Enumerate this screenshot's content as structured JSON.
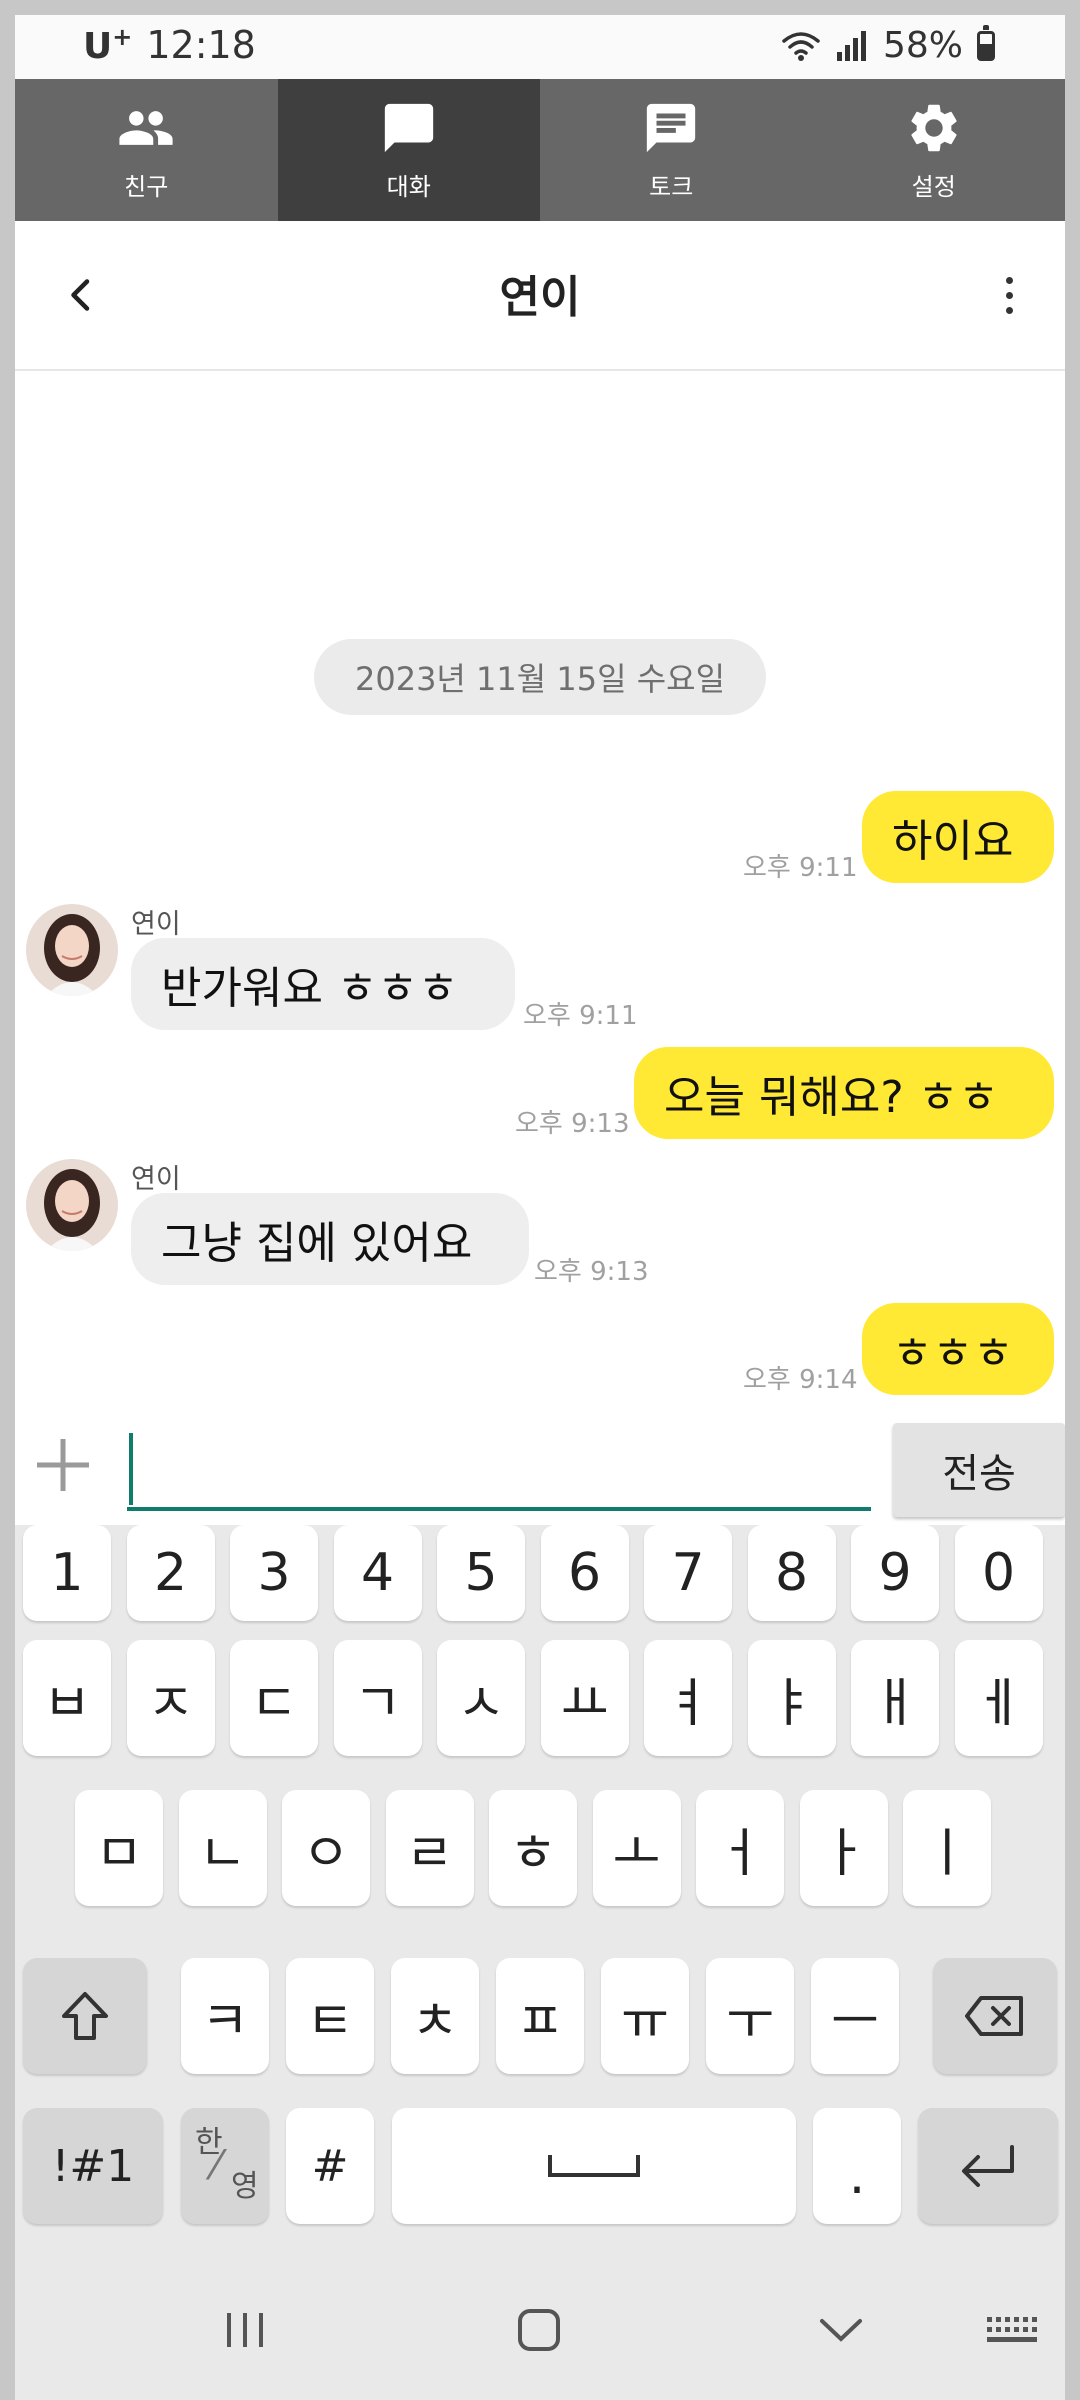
{
  "status_bar": {
    "carrier": "U",
    "carrier_sup": "+",
    "time": "12:18",
    "battery": "58%"
  },
  "tabs": [
    {
      "label": "친구",
      "icon": "friends-icon",
      "active": false
    },
    {
      "label": "대화",
      "icon": "chat-bubble-icon",
      "active": true
    },
    {
      "label": "토크",
      "icon": "message-icon",
      "active": false
    },
    {
      "label": "설정",
      "icon": "gear-icon",
      "active": false
    }
  ],
  "chat": {
    "title": "연이",
    "date_divider": "2023년 11월 15일 수요일",
    "messages": [
      {
        "from": "me",
        "text": "하이요",
        "time": "오후 9:11"
      },
      {
        "from": "them",
        "sender": "연이",
        "text": "반가워요 ㅎㅎㅎ",
        "time": "오후 9:11"
      },
      {
        "from": "me",
        "text": "오늘 뭐해요? ㅎㅎ",
        "time": "오후 9:13"
      },
      {
        "from": "them",
        "sender": "연이",
        "text": "그냥 집에 있어요",
        "time": "오후 9:13"
      },
      {
        "from": "me",
        "text": "ㅎㅎㅎ",
        "time": "오후 9:14"
      }
    ]
  },
  "input": {
    "value": "",
    "placeholder": "",
    "send_label": "전송"
  },
  "keyboard": {
    "row_numbers": [
      "1",
      "2",
      "3",
      "4",
      "5",
      "6",
      "7",
      "8",
      "9",
      "0"
    ],
    "row1": [
      "ㅂ",
      "ㅈ",
      "ㄷ",
      "ㄱ",
      "ㅅ",
      "ㅛ",
      "ㅕ",
      "ㅑ",
      "ㅐ",
      "ㅔ"
    ],
    "row2": [
      "ㅁ",
      "ㄴ",
      "ㅇ",
      "ㄹ",
      "ㅎ",
      "ㅗ",
      "ㅓ",
      "ㅏ",
      "ㅣ"
    ],
    "row3": [
      "ㅋ",
      "ㅌ",
      "ㅊ",
      "ㅍ",
      "ㅠ",
      "ㅜ",
      "ㅡ"
    ],
    "symbols_label": "!#1",
    "lang_top": "한",
    "lang_bottom": "영",
    "hash_label": "#",
    "period_label": "."
  },
  "colors": {
    "my_bubble": "#ffe934",
    "their_bubble": "#eeeeee",
    "tab_bg": "#676767",
    "tab_active": "#3f3f3f",
    "accent": "#107c6d"
  }
}
